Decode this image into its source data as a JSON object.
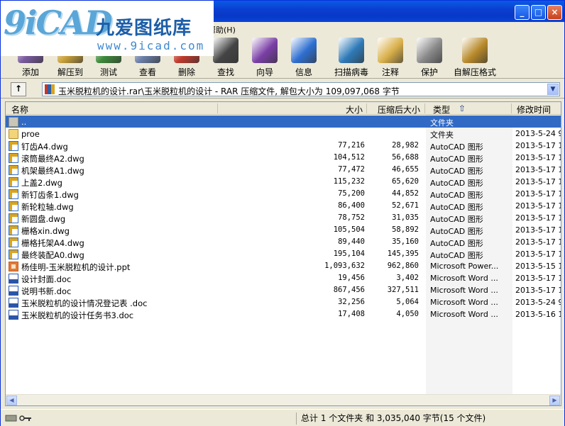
{
  "window": {
    "controls": [
      "_",
      "□",
      "×"
    ]
  },
  "watermark": {
    "logo_letters": "9iCAD",
    "title": "九爱图纸库",
    "url": "www.9icad.com"
  },
  "menu": {
    "help": "帮助(H)"
  },
  "toolbar": {
    "items": [
      {
        "label": "添加",
        "icon": "add-archive-icon",
        "color": "#7a5a9e"
      },
      {
        "label": "解压到",
        "icon": "extract-icon",
        "color": "#c9a23a"
      },
      {
        "label": "测试",
        "icon": "test-icon",
        "color": "#3d8a3a"
      },
      {
        "label": "查看",
        "icon": "view-icon",
        "color": "#6b7fa8"
      },
      {
        "label": "删除",
        "icon": "delete-icon",
        "color": "#c0392b"
      },
      {
        "label": "查找",
        "icon": "find-icon",
        "color": "#444444"
      },
      {
        "label": "向导",
        "icon": "wizard-icon",
        "color": "#7a3fa6"
      },
      {
        "label": "信息",
        "icon": "info-icon",
        "color": "#2e6fd1"
      },
      {
        "label": "扫描病毒",
        "icon": "virus-scan-icon",
        "color": "#2e7ab8"
      },
      {
        "label": "注释",
        "icon": "comment-icon",
        "color": "#d9b04a"
      },
      {
        "label": "保护",
        "icon": "protect-icon",
        "color": "#8a8a8a"
      },
      {
        "label": "自解压格式",
        "icon": "sfx-icon",
        "color": "#b88a2a"
      }
    ]
  },
  "address": {
    "up_glyph": "↑",
    "path": "玉米脱粒机的设计.rar\\玉米脱粒机的设计 - RAR 压缩文件, 解包大小为 109,097,068 字节",
    "drop_glyph": "▼"
  },
  "columns": {
    "name": "名称",
    "size": "大小",
    "packed": "压缩后大小",
    "type": "类型",
    "sort_glyph": "⇧",
    "time": "修改时间"
  },
  "files": [
    {
      "name": "..",
      "size": "",
      "packed": "",
      "type": "文件夹",
      "time": "",
      "kind": "up",
      "selected": true
    },
    {
      "name": "proe",
      "size": "",
      "packed": "",
      "type": "文件夹",
      "time": "2013-5-24 9",
      "kind": "folder"
    },
    {
      "name": "钉齿A4.dwg",
      "size": "77,216",
      "packed": "28,982",
      "type": "AutoCAD 图形",
      "time": "2013-5-17 1",
      "kind": "dwg"
    },
    {
      "name": "滚筒最终A2.dwg",
      "size": "104,512",
      "packed": "56,688",
      "type": "AutoCAD 图形",
      "time": "2013-5-17 1",
      "kind": "dwg"
    },
    {
      "name": "机架最终A1.dwg",
      "size": "77,472",
      "packed": "46,655",
      "type": "AutoCAD 图形",
      "time": "2013-5-17 1",
      "kind": "dwg"
    },
    {
      "name": "上盖2.dwg",
      "size": "115,232",
      "packed": "65,620",
      "type": "AutoCAD 图形",
      "time": "2013-5-17 1",
      "kind": "dwg"
    },
    {
      "name": "新钉齿条1.dwg",
      "size": "75,200",
      "packed": "44,852",
      "type": "AutoCAD 图形",
      "time": "2013-5-17 1",
      "kind": "dwg"
    },
    {
      "name": "新轮粒轴.dwg",
      "size": "86,400",
      "packed": "52,671",
      "type": "AutoCAD 图形",
      "time": "2013-5-17 1",
      "kind": "dwg"
    },
    {
      "name": "新圆盘.dwg",
      "size": "78,752",
      "packed": "31,035",
      "type": "AutoCAD 图形",
      "time": "2013-5-17 1",
      "kind": "dwg"
    },
    {
      "name": "栅格xin.dwg",
      "size": "105,504",
      "packed": "58,892",
      "type": "AutoCAD 图形",
      "time": "2013-5-17 1",
      "kind": "dwg"
    },
    {
      "name": "栅格托架A4.dwg",
      "size": "89,440",
      "packed": "35,160",
      "type": "AutoCAD 图形",
      "time": "2013-5-17 1",
      "kind": "dwg"
    },
    {
      "name": "最终装配A0.dwg",
      "size": "195,104",
      "packed": "145,395",
      "type": "AutoCAD 图形",
      "time": "2013-5-17 1",
      "kind": "dwg"
    },
    {
      "name": "杨佳明-玉米脱粒机的设计.ppt",
      "size": "1,093,632",
      "packed": "962,860",
      "type": "Microsoft Power...",
      "time": "2013-5-15 1",
      "kind": "ppt"
    },
    {
      "name": "设计封面.doc",
      "size": "19,456",
      "packed": "3,402",
      "type": "Microsoft Word ...",
      "time": "2013-5-17 1",
      "kind": "doc"
    },
    {
      "name": "说明书新.doc",
      "size": "867,456",
      "packed": "327,511",
      "type": "Microsoft Word ...",
      "time": "2013-5-17 1",
      "kind": "doc"
    },
    {
      "name": "玉米脱粒机的设计情况登记表 .doc",
      "size": "32,256",
      "packed": "5,064",
      "type": "Microsoft Word ...",
      "time": "2013-5-24 9",
      "kind": "doc"
    },
    {
      "name": "玉米脱粒机的设计任务书3.doc",
      "size": "17,408",
      "packed": "4,050",
      "type": "Microsoft Word ...",
      "time": "2013-5-16 1",
      "kind": "doc"
    }
  ],
  "scroll": {
    "left": "◀",
    "right": "▶"
  },
  "status": {
    "text": "总计 1 个文件夹 和 3,035,040 字节(15 个文件)"
  }
}
